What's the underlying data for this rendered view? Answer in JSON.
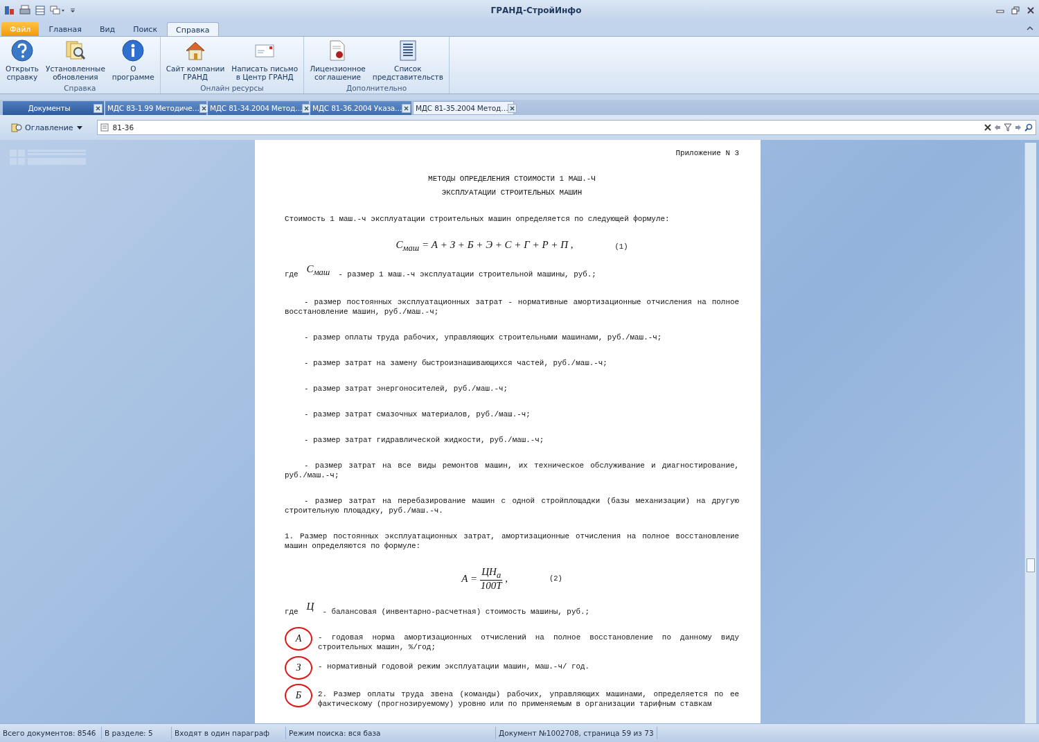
{
  "window": {
    "title": "ГРАНД-СтройИнфо"
  },
  "ribbon_tabs": [
    {
      "label": "Файл",
      "kind": "file",
      "selected": false
    },
    {
      "label": "Главная",
      "kind": "tab",
      "selected": false
    },
    {
      "label": "Вид",
      "kind": "tab",
      "selected": false
    },
    {
      "label": "Поиск",
      "kind": "tab",
      "selected": false
    },
    {
      "label": "Справка",
      "kind": "tab",
      "selected": true
    }
  ],
  "ribbon_groups": [
    {
      "title": "Справка",
      "buttons": [
        {
          "lines": [
            "Открыть",
            "справку"
          ],
          "kind": "help"
        },
        {
          "lines": [
            "Установленные",
            "обновления"
          ],
          "kind": "updates"
        },
        {
          "lines": [
            "О",
            "программе"
          ],
          "kind": "info"
        }
      ]
    },
    {
      "title": "Онлайн ресурсы",
      "buttons": [
        {
          "lines": [
            "Сайт компании",
            "ГРАНД"
          ],
          "kind": "home"
        },
        {
          "lines": [
            "Написать письмо",
            "в Центр ГРАНД"
          ],
          "kind": "mail"
        }
      ]
    },
    {
      "title": "Дополнительно",
      "buttons": [
        {
          "lines": [
            "Лицензионное",
            "соглашение"
          ],
          "kind": "license"
        },
        {
          "lines": [
            "Список",
            "представительств"
          ],
          "kind": "list"
        }
      ]
    }
  ],
  "doc_tabs": [
    {
      "label": "Документы",
      "kind": "home",
      "selected": false
    },
    {
      "label": "МДС 83-1.99 Методиче…",
      "kind": "doc",
      "selected": false
    },
    {
      "label": "МДС 81-34.2004 Метод…",
      "kind": "doc",
      "selected": false
    },
    {
      "label": "МДС 81-36.2004 Указа…",
      "kind": "doc",
      "selected": false
    },
    {
      "label": "МДС 81-35.2004 Метод…",
      "kind": "doc",
      "selected": true
    }
  ],
  "toc_button": {
    "label": "Оглавление"
  },
  "search": {
    "value": "81-36"
  },
  "document": {
    "paragraphs": [
      {
        "kind": "right",
        "text": "Приложение N 3"
      },
      {
        "kind": "heading",
        "text": "МЕТОДЫ ОПРЕДЕЛЕНИЯ СТОИМОСТИ 1 МАШ.-Ч"
      },
      {
        "kind": "heading",
        "text": "ЭКСПЛУАТАЦИИ СТРОИТЕЛЬНЫХ МАШИН"
      },
      {
        "kind": "plain",
        "text": "Стоимость 1 маш.-ч эксплуатации строительных машин определяется по следующей формуле:"
      },
      {
        "kind": "formula",
        "formula": "С$_{маш}$ = А + З + Б + Э + С + Г + Р + П ,",
        "number": "(1)"
      },
      {
        "kind": "where",
        "lead": "где",
        "symbol": "С$_{маш}$",
        "text": "- размер 1 маш.-ч эксплуатации строительной машины, руб.;"
      },
      {
        "kind": "indent",
        "text": "- размер постоянных эксплуатационных затрат - нормативные амортизационные отчисления на полное восстановление машин, руб./маш.-ч;"
      },
      {
        "kind": "indent",
        "text": "- размер оплаты труда рабочих, управляющих строительными машинами, руб./маш.-ч;"
      },
      {
        "kind": "indent",
        "text": "- размер затрат на замену быстроизнашивающихся частей, руб./маш.-ч;"
      },
      {
        "kind": "indent",
        "text": "- размер затрат энергоносителей, руб./маш.-ч;"
      },
      {
        "kind": "indent",
        "text": "- размер затрат смазочных материалов, руб./маш.-ч;"
      },
      {
        "kind": "indent",
        "text": "- размер затрат гидравлической жидкости, руб./маш.-ч;"
      },
      {
        "kind": "indent",
        "text": "- размер затрат на все виды ремонтов машин, их техническое обслуживание и диагностирование, руб./маш.-ч;"
      },
      {
        "kind": "indent",
        "text": "- размер затрат на перебазирование машин с одной стройплощадки (базы механизации) на другую строительную площадку, руб./маш.-ч."
      },
      {
        "kind": "plain",
        "text": "1. Размер постоянных эксплуатационных затрат, амортизационные отчисления на полное восстановление машин определяются по формуле:"
      },
      {
        "kind": "fraction",
        "lhs": "А =",
        "numerator": "ЦН$_{а}$",
        "denominator": "100Т",
        "suffix": ",",
        "number": "(2)"
      },
      {
        "kind": "where",
        "lead": "где",
        "symbol": "Ц",
        "text": "- балансовая (инвентарно-расчетная) стоимость машины, руб.;"
      },
      {
        "kind": "circled",
        "symbol": "А",
        "text": "- годовая норма амортизационных отчислений на полное восстановление по данному виду строительных машин, %/год;"
      },
      {
        "kind": "circled",
        "symbol": "З",
        "text": "- нормативный годовой режим эксплуатации машин, маш.-ч/ год."
      },
      {
        "kind": "circled",
        "symbol": "Б",
        "text": "2. Размер оплаты труда звена (команды) рабочих, управляющих машинами, определяется по ее фактическому (прогнозируемому) уровню или по применяемым в организации тарифным ставкам"
      }
    ]
  },
  "status_bar": [
    "Всего документов: 8546",
    "В разделе: 5",
    "Входят в один параграф",
    "Режим поиска: вся база",
    "Документ №1002708, страница 59 из 73"
  ]
}
